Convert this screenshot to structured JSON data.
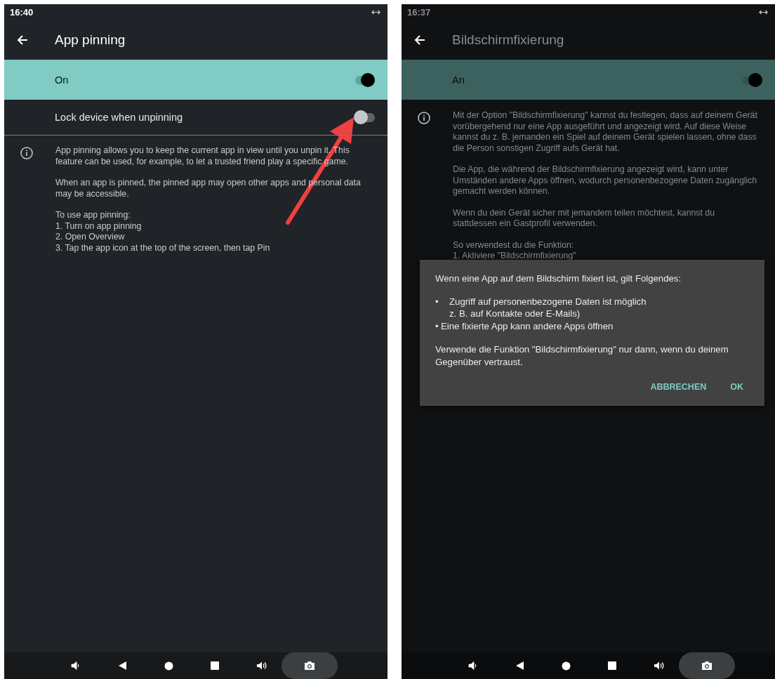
{
  "screens": [
    {
      "status_time": "16:40",
      "title": "App pinning",
      "dimmed": false,
      "switches": [
        {
          "label": "On",
          "on": true,
          "highlighted": true
        },
        {
          "label": "Lock device when unpinning",
          "on": false,
          "highlighted": false
        }
      ],
      "info": [
        "App pinning allows you to keep the current app in view until you unpin it. This feature can be used, for example, to let a trusted friend play a specific game.",
        "When an app is pinned, the pinned app may open other apps and personal data may be accessible.",
        "To use app pinning:\n1. Turn on app pinning\n2. Open Overview\n3. Tap the app icon at the top of the screen, then tap Pin"
      ],
      "annotation_arrow": true
    },
    {
      "status_time": "16:37",
      "title": "Bildschirmfixierung",
      "dimmed": true,
      "switches": [
        {
          "label": "An",
          "on": true,
          "highlighted": true
        }
      ],
      "info": [
        "Mit der Option \"Bildschirmfixierung\" kannst du festlegen, dass auf deinem Gerät vorübergehend nur eine App ausgeführt und angezeigt wird. Auf diese Weise kannst du z. B. jemanden ein Spiel auf deinem Gerät spielen lassen, ohne dass die Person sonstigen Zugriff aufs Gerät hat.",
        "Die App, die während der Bildschirmfixierung angezeigt wird, kann unter Umständen andere Apps öffnen, wodurch personenbezogene Daten zugänglich gemacht werden können.",
        "Wenn du dein Gerät sicher mit jemandem teilen möchtest, kannst du stattdessen ein Gastprofil verwenden.",
        "So verwendest du die Funktion:\n1. Aktiviere \"Bildschirmfixierung\""
      ],
      "dialog": {
        "intro": "Wenn eine App auf dem Bildschirm fixiert ist, gilt Folgendes:",
        "bullets": [
          {
            "marker": "•",
            "text": "Zugriff auf personenbezogene Daten ist möglich\nz. B. auf Kontakte oder E-Mails)",
            "wide": true
          },
          {
            "marker": "•",
            "text": "Eine fixierte App kann andere Apps öffnen",
            "wide": false
          }
        ],
        "closing": "Verwende die Funktion \"Bildschirmfixierung\" nur dann, wenn du deinem Gegenüber vertraust.",
        "buttons": [
          "ABBRECHEN",
          "OK"
        ]
      }
    }
  ]
}
